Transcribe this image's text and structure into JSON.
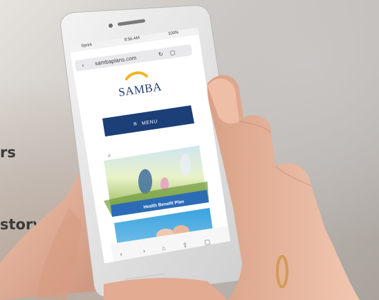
{
  "background": {
    "text_line_1": "rs",
    "text_line_2": "story"
  },
  "phone": {
    "status_bar": {
      "carrier": "Sprint",
      "time": "8:56 AM",
      "battery": "100%"
    },
    "url_bar": {
      "url": "sambaplans.com"
    },
    "site": {
      "logo_text": "SAMBA",
      "menu_label": "MENU",
      "card_1_caption": "Health Benefit Plan"
    }
  },
  "colors": {
    "brand_navy": "#1d3f77",
    "card_blue": "#2c6cb6",
    "skin": "#e8b69d"
  }
}
